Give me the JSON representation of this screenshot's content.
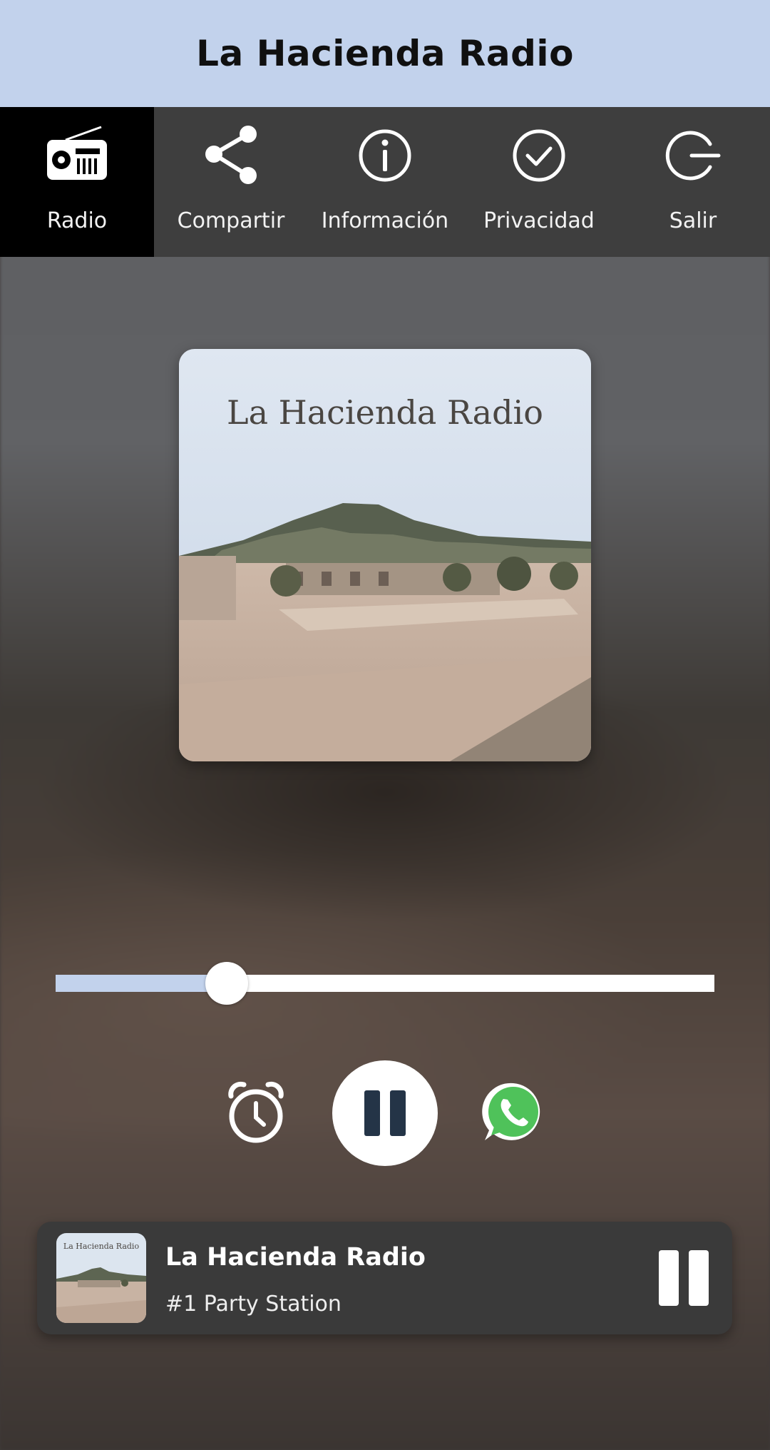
{
  "app": {
    "title": "La Hacienda Radio"
  },
  "nav": {
    "items": [
      {
        "label": "Radio",
        "icon": "radio-icon",
        "active": true
      },
      {
        "label": "Compartir",
        "icon": "share-icon",
        "active": false
      },
      {
        "label": "Información",
        "icon": "info-icon",
        "active": false
      },
      {
        "label": "Privacidad",
        "icon": "check-circle-icon",
        "active": false
      },
      {
        "label": "Salir",
        "icon": "exit-icon",
        "active": false
      }
    ]
  },
  "artwork": {
    "caption": "La Hacienda Radio"
  },
  "volume": {
    "level": 0.26
  },
  "controls": {
    "timer_icon": "alarm-clock-icon",
    "play_state": "playing",
    "share_icon": "whatsapp-icon"
  },
  "now_playing": {
    "station": "La Hacienda Radio",
    "tagline": "#1 Party Station",
    "thumb_caption": "La Hacienda Radio"
  },
  "colors": {
    "header_bg": "#c2d2ec",
    "nav_bg": "#3e3e3e",
    "nav_active_bg": "#000000",
    "accent": "#c2d2ec",
    "pause_icon": "#243447",
    "whatsapp": "#4fc25a"
  }
}
